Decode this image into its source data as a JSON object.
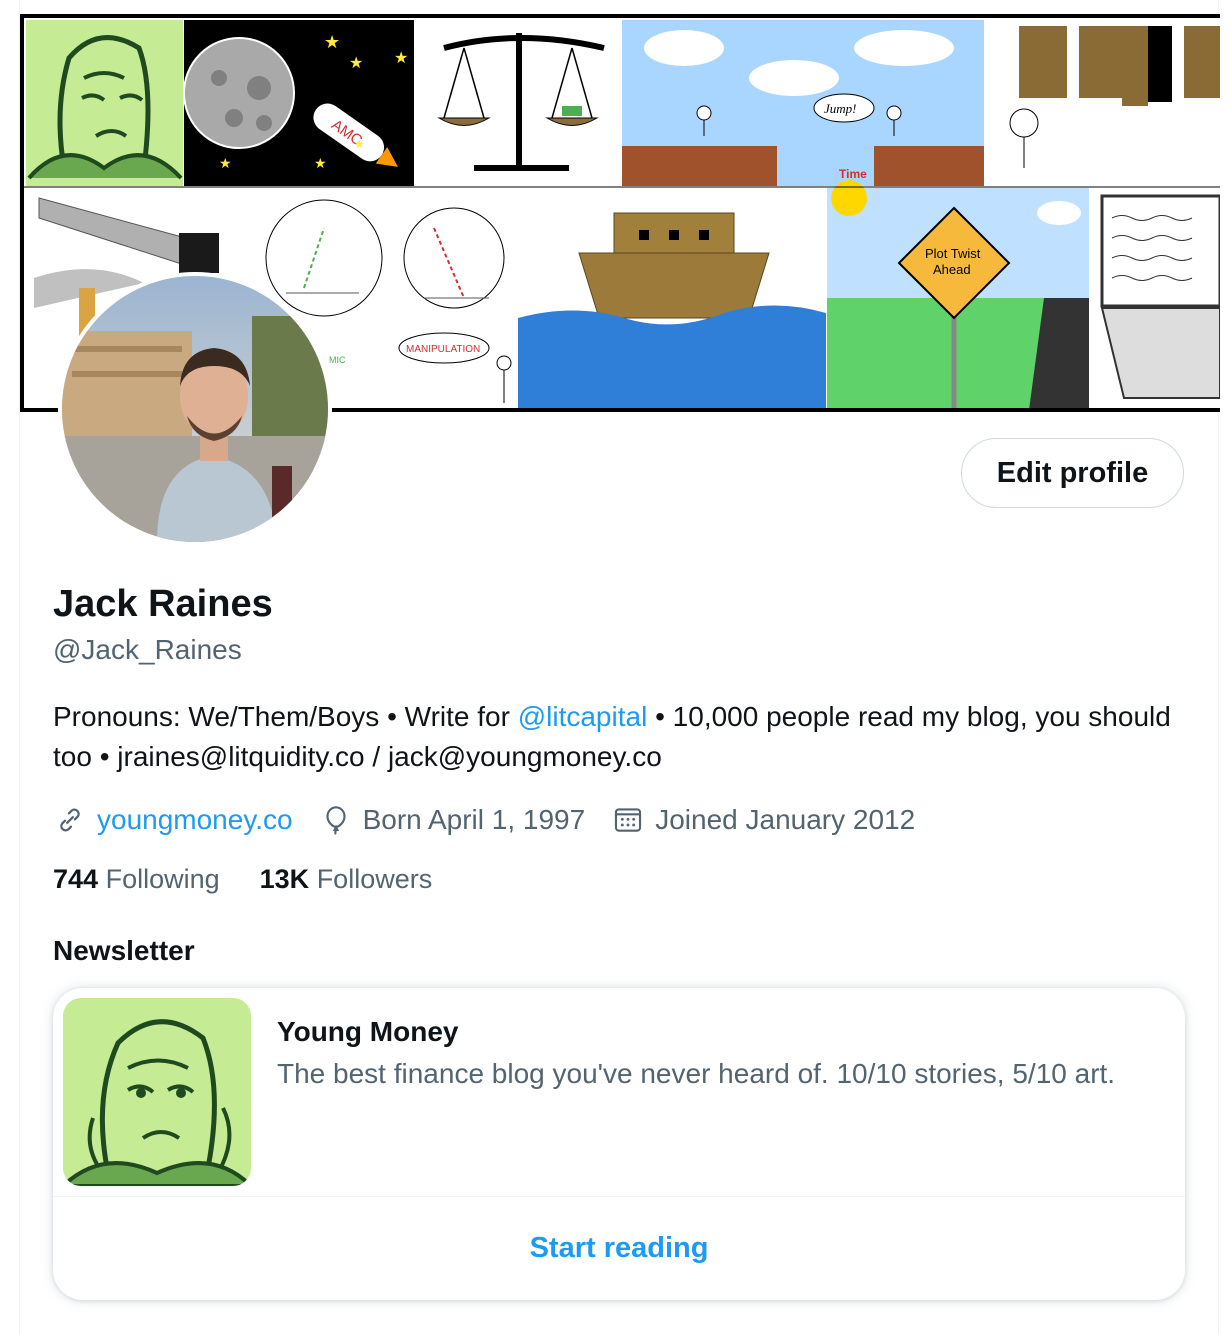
{
  "profile": {
    "name": "Jack Raines",
    "handle": "@Jack_Raines",
    "edit_label": "Edit profile",
    "bio": {
      "before": "Pronouns: We/Them/Boys • Write for ",
      "mention": "@litcapital",
      "after": " • 10,000 people read my blog, you should too • jraines@litquidity.co / jack@youngmoney.co"
    },
    "meta": {
      "website": "youngmoney.co",
      "birthday": "Born April 1, 1997",
      "joined": "Joined January 2012"
    },
    "stats": {
      "following_count": "744",
      "following_label": "Following",
      "followers_count": "13K",
      "followers_label": "Followers"
    }
  },
  "banner": {
    "texts": {
      "amc": "AMC",
      "jump": "Jump!",
      "time": "Time",
      "plot_twist_1": "Plot Twist",
      "plot_twist_2": "Ahead",
      "manipulation": "MANIPULATION",
      "mic": "MIC"
    }
  },
  "newsletter": {
    "section_title": "Newsletter",
    "title": "Young Money",
    "description": "The best finance blog you've never heard of. 10/10 stories, 5/10 art.",
    "cta": "Start reading"
  },
  "colors": {
    "accent": "#1d9bf0",
    "secondary_text": "#536471",
    "primary_text": "#0f1419",
    "border": "#cfd9de"
  },
  "icons": [
    "link-icon",
    "balloon-icon",
    "calendar-icon"
  ]
}
